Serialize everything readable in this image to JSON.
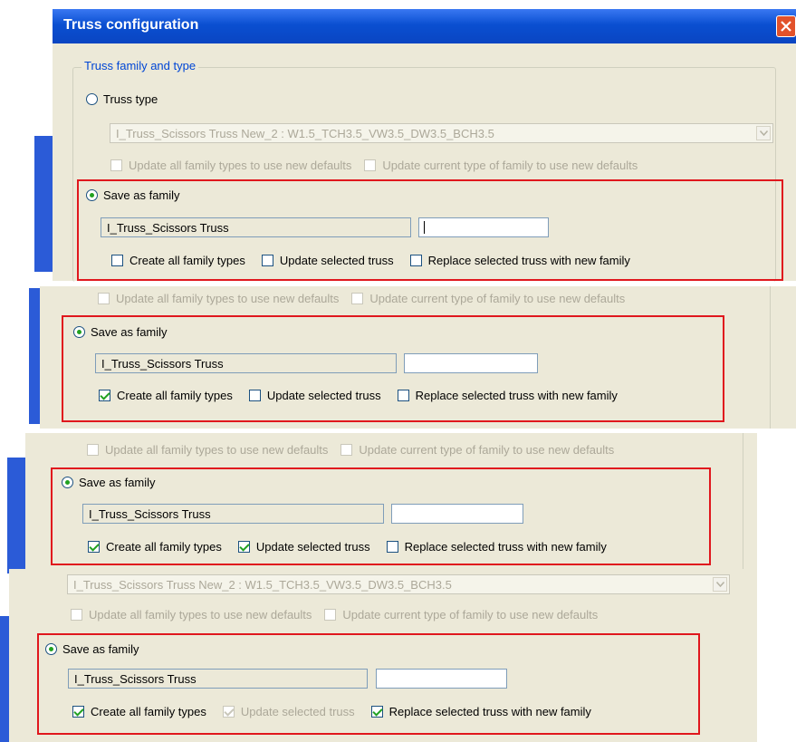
{
  "dialog": {
    "title": "Truss configuration",
    "group_label": "Truss family and type",
    "truss_type_label": "Truss type",
    "truss_type_value": "I_Truss_Scissors Truss New_2 : W1.5_TCH3.5_VW3.5_DW3.5_BCH3.5"
  },
  "labels": {
    "update_all_types": "Update all family types to use new defaults",
    "update_current_type": "Update current type of family to use new defaults",
    "save_as_family": "Save as family",
    "family_name": "I_Truss_Scissors Truss",
    "create_all_types": "Create all family types",
    "update_selected_truss": "Update selected truss",
    "replace_selected_truss": "Replace selected truss with new family"
  },
  "states": [
    {
      "save_as_family": true,
      "create_all_types": false,
      "update_selected_truss": false,
      "update_selected_disabled": false,
      "replace_selected_truss": false,
      "name_input": "",
      "caret": true
    },
    {
      "save_as_family": true,
      "create_all_types": true,
      "update_selected_truss": false,
      "update_selected_disabled": false,
      "replace_selected_truss": false,
      "name_input": ""
    },
    {
      "save_as_family": true,
      "create_all_types": true,
      "update_selected_truss": true,
      "update_selected_disabled": false,
      "replace_selected_truss": false,
      "name_input": ""
    },
    {
      "save_as_family": true,
      "create_all_types": true,
      "update_selected_truss": true,
      "update_selected_disabled": true,
      "replace_selected_truss": true,
      "name_input": ""
    }
  ],
  "colors": {
    "titlebar": "#0a4fd1",
    "panel": "#ece9d8",
    "highlight_box": "#e0171d",
    "check_mark": "#21a121",
    "group_label": "#0046d5",
    "disabled_text": "#aca899"
  },
  "icons": [
    "close-icon",
    "dropdown-arrow-icon"
  ]
}
